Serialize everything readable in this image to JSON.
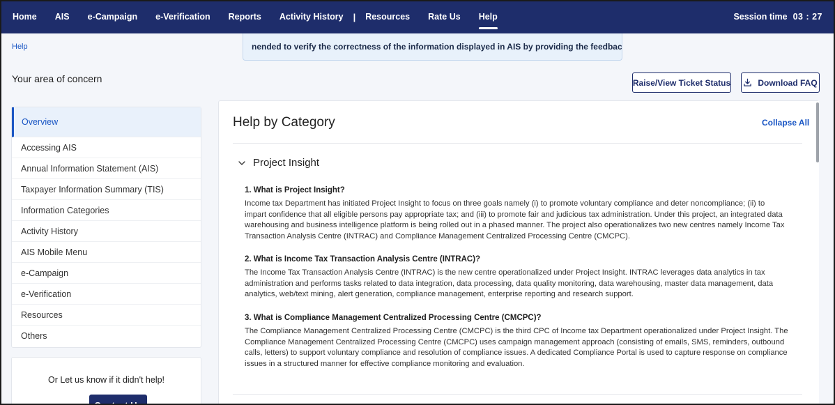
{
  "nav": {
    "items": [
      "Home",
      "AIS",
      "e-Campaign",
      "e-Verification",
      "Reports",
      "Activity History",
      "Resources",
      "Rate Us",
      "Help"
    ],
    "separator": "|",
    "active": "Help",
    "session_label": "Session time",
    "session_time": "03 : 27"
  },
  "breadcrumb": "Help",
  "banner_text": "nended to verify the correctness of the information displayed in AIS by providing the feedback.",
  "concern_title": "Your area of concern",
  "buttons": {
    "raise": "Raise/View Ticket Status",
    "download": "Download FAQ"
  },
  "sidebar": {
    "items": [
      "Overview",
      "Accessing AIS",
      "Annual Information Statement (AIS)",
      "Taxpayer Information Summary (TIS)",
      "Information Categories",
      "Activity History",
      "AIS Mobile Menu",
      "e-Campaign",
      "e-Verification",
      "Resources",
      "Others"
    ],
    "active": "Overview"
  },
  "contact": {
    "text": "Or Let us know if it didn't help!",
    "button": "Contact Us"
  },
  "main": {
    "title": "Help by Category",
    "collapse_all": "Collapse All",
    "section_title": "Project Insight",
    "faqs": [
      {
        "q": "1. What is Project Insight?",
        "a": [
          "Income tax Department has initiated Project Insight to focus on three goals namely (i) to promote voluntary compliance and deter noncompliance; (ii) to",
          "impart confidence that all eligible persons pay appropriate tax; and (iii) to promote fair and judicious tax administration. Under this project, an integrated data",
          "warehousing and business intelligence platform is being rolled out in a phased manner. The project also operationalizes two new centres namely Income Tax",
          "Transaction Analysis Centre (INTRAC) and Compliance Management Centralized Processing Centre (CMCPC)."
        ]
      },
      {
        "q": "2. What is Income Tax Transaction Analysis Centre (INTRAC)?",
        "a": [
          "The Income Tax Transaction Analysis Centre (INTRAC) is the new centre operationalized under Project Insight. INTRAC leverages data analytics in tax",
          "administration and performs tasks related to data integration, data processing, data quality monitoring, data warehousing, master data management, data",
          "analytics, web/text mining, alert generation, compliance management, enterprise reporting and research support."
        ]
      },
      {
        "q": "3. What is Compliance Management Centralized Processing Centre (CMCPC)?",
        "a": [
          "The Compliance Management Centralized Processing Centre (CMCPC) is the third CPC of Income tax Department operationalized under Project Insight. The",
          "Compliance Management Centralized Processing Centre (CMCPC) uses campaign management approach (consisting of emails, SMS, reminders, outbound",
          "calls, letters) to support voluntary compliance and resolution of compliance issues. A dedicated Compliance Portal is used to capture response on compliance",
          "issues in a structured manner for effective compliance monitoring and evaluation."
        ]
      }
    ]
  },
  "colors": {
    "nav_bg": "#1e2d6b",
    "link": "#1a56c4",
    "banner_bg": "#e8f1fb",
    "sidebar_active_bg": "#e9f1fb"
  },
  "icons": [
    "download-icon",
    "chevron-down-icon"
  ]
}
